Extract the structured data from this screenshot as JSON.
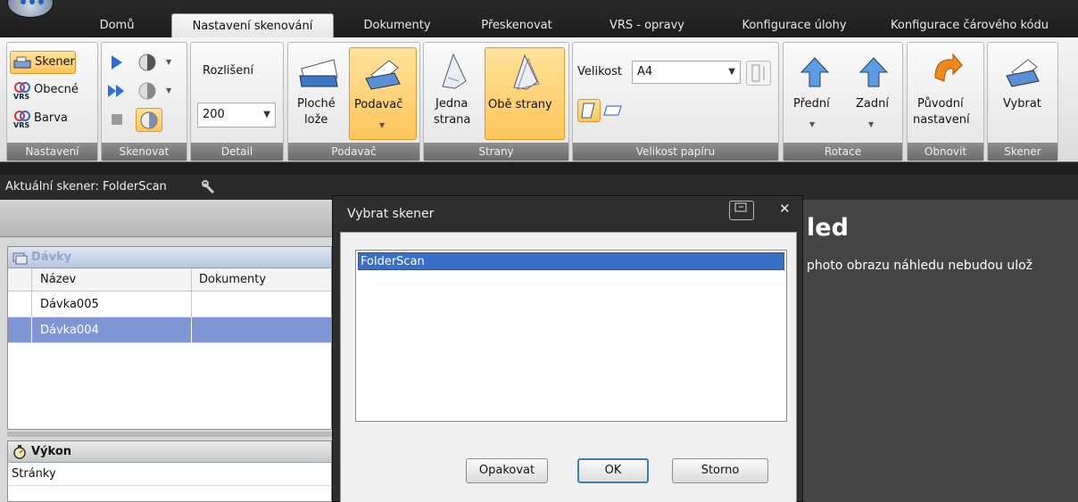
{
  "tabs": [
    "Domů",
    "Nastavení skenování",
    "Dokumenty",
    "Přeskenovat",
    "VRS - opravy",
    "Konfigurace úlohy",
    "Konfigurace čárového kódu"
  ],
  "active_tab_index": 1,
  "ribbon": {
    "settings": {
      "skener": "Skener",
      "obecne": "Obecné",
      "barva": "Barva",
      "label": "Nastavení"
    },
    "scan": {
      "label": "Skenovat"
    },
    "detail": {
      "resolution_label": "Rozlišení",
      "resolution_value": "200",
      "label": "Detail"
    },
    "feeder": {
      "flatbed_line1": "Ploché",
      "flatbed_line2": "lože",
      "feeder_btn": "Podavač",
      "label": "Podavač"
    },
    "sides": {
      "one_line1": "Jedna",
      "one_line2": "strana",
      "both": "Obě strany",
      "label": "Strany"
    },
    "paper": {
      "size_label": "Velikost",
      "size_value": "A4",
      "label": "Velikost papíru"
    },
    "rotation": {
      "front": "Přední",
      "back": "Zadní",
      "label": "Rotace"
    },
    "restore": {
      "line1": "Původní",
      "line2": "nastavení",
      "label": "Obnovit"
    },
    "scanner": {
      "select": "Vybrat",
      "label": "Skener"
    }
  },
  "status": {
    "current_scanner": "Aktuální skener: FolderScan"
  },
  "batches": {
    "title": "Dávky",
    "columns": [
      "Název",
      "Dokumenty"
    ],
    "rows": [
      {
        "name": "Dávka005",
        "docs": ""
      },
      {
        "name": "Dávka004",
        "docs": ""
      }
    ],
    "selected_index": 1
  },
  "performance": {
    "title": "Výkon",
    "pages_label": "Stránky"
  },
  "preview": {
    "title_partial": "led",
    "note_partial": "photo obrazu náhledu nebudou ulož"
  },
  "dialog": {
    "title": "Vybrat skener",
    "items": [
      "FolderScan"
    ],
    "retry": "Opakovat",
    "ok": "OK",
    "cancel": "Storno"
  },
  "colors": {
    "accent_selected": "#7f95d6",
    "highlight": "#ffc55a",
    "dialog_bg": "#2e2e2e"
  }
}
